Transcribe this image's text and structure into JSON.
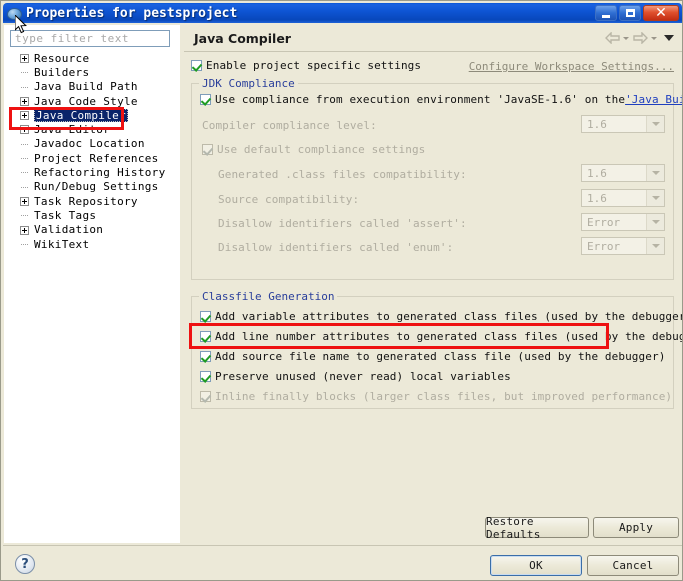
{
  "window": {
    "title": "Properties for pestsproject",
    "icon": "eclipse-ball-icon",
    "minimize_label": "Minimize",
    "maximize_label": "Maximize",
    "close_label": "Close"
  },
  "sidebar": {
    "filter": {
      "placeholder": "type filter text",
      "value": ""
    },
    "items": [
      {
        "label": "Resource",
        "expandable": true,
        "selected": false
      },
      {
        "label": "Builders",
        "expandable": false,
        "selected": false
      },
      {
        "label": "Java Build Path",
        "expandable": false,
        "selected": false
      },
      {
        "label": "Java Code Style",
        "expandable": true,
        "selected": false
      },
      {
        "label": "Java Compiler",
        "expandable": true,
        "selected": true
      },
      {
        "label": "Java Editor",
        "expandable": true,
        "selected": false
      },
      {
        "label": "Javadoc Location",
        "expandable": false,
        "selected": false
      },
      {
        "label": "Project References",
        "expandable": false,
        "selected": false
      },
      {
        "label": "Refactoring History",
        "expandable": false,
        "selected": false
      },
      {
        "label": "Run/Debug Settings",
        "expandable": false,
        "selected": false
      },
      {
        "label": "Task Repository",
        "expandable": true,
        "selected": false
      },
      {
        "label": "Task Tags",
        "expandable": false,
        "selected": false
      },
      {
        "label": "Validation",
        "expandable": true,
        "selected": false
      },
      {
        "label": "WikiText",
        "expandable": false,
        "selected": false
      }
    ]
  },
  "page": {
    "title": "Java Compiler",
    "back_icon": "back-arrow-icon",
    "forward_icon": "forward-arrow-icon",
    "menu_icon": "chevron-down-icon",
    "enable_project_specific": {
      "label": "Enable project specific settings",
      "checked": true,
      "enabled": true
    },
    "configure_workspace_link": "Configure Workspace Settings...",
    "jdk_compliance": {
      "legend": "JDK Compliance",
      "use_execution_env": {
        "text_before": "Use compliance from execution environment 'JavaSE-1.6' on the ",
        "link": "'Java Build Path'",
        "checked": true,
        "enabled": true
      },
      "fields": [
        {
          "label": "Compiler compliance level:",
          "value": "1.6",
          "enabled": false
        },
        {
          "label": "Generated .class files compatibility:",
          "value": "1.6",
          "enabled": false
        },
        {
          "label": "Source compatibility:",
          "value": "1.6",
          "enabled": false
        },
        {
          "label": "Disallow identifiers called 'assert':",
          "value": "Error",
          "enabled": false
        },
        {
          "label": "Disallow identifiers called 'enum':",
          "value": "Error",
          "enabled": false
        }
      ],
      "use_default_settings": {
        "label": "Use default compliance settings",
        "checked": true,
        "enabled": false
      }
    },
    "classfile_generation": {
      "legend": "Classfile Generation",
      "options": [
        {
          "label": "Add variable attributes to generated class files (used by the debugger)",
          "checked": true,
          "enabled": true,
          "highlighted": false
        },
        {
          "label": "Add line number attributes to generated class files (used by the debugger)",
          "checked": true,
          "enabled": true,
          "highlighted": false
        },
        {
          "label": "Add source file name to generated class file (used by the debugger)",
          "checked": true,
          "enabled": true,
          "highlighted": true
        },
        {
          "label": "Preserve unused (never read) local variables",
          "checked": true,
          "enabled": true,
          "highlighted": false
        },
        {
          "label": "Inline finally blocks (larger class files, but improved performance)",
          "checked": true,
          "enabled": false,
          "highlighted": false
        }
      ]
    }
  },
  "buttons": {
    "restore_defaults": "Restore Defaults",
    "apply": "Apply",
    "ok": "OK",
    "cancel": "Cancel",
    "help": "?"
  },
  "annotations": {
    "color": "#ee1111",
    "boxes": [
      {
        "name": "java-compiler-tree-item",
        "note": "red rectangle around Java Compiler in the tree"
      },
      {
        "name": "add-source-file-name-option",
        "note": "red rectangle around the Add source file name checkbox row"
      }
    ]
  }
}
